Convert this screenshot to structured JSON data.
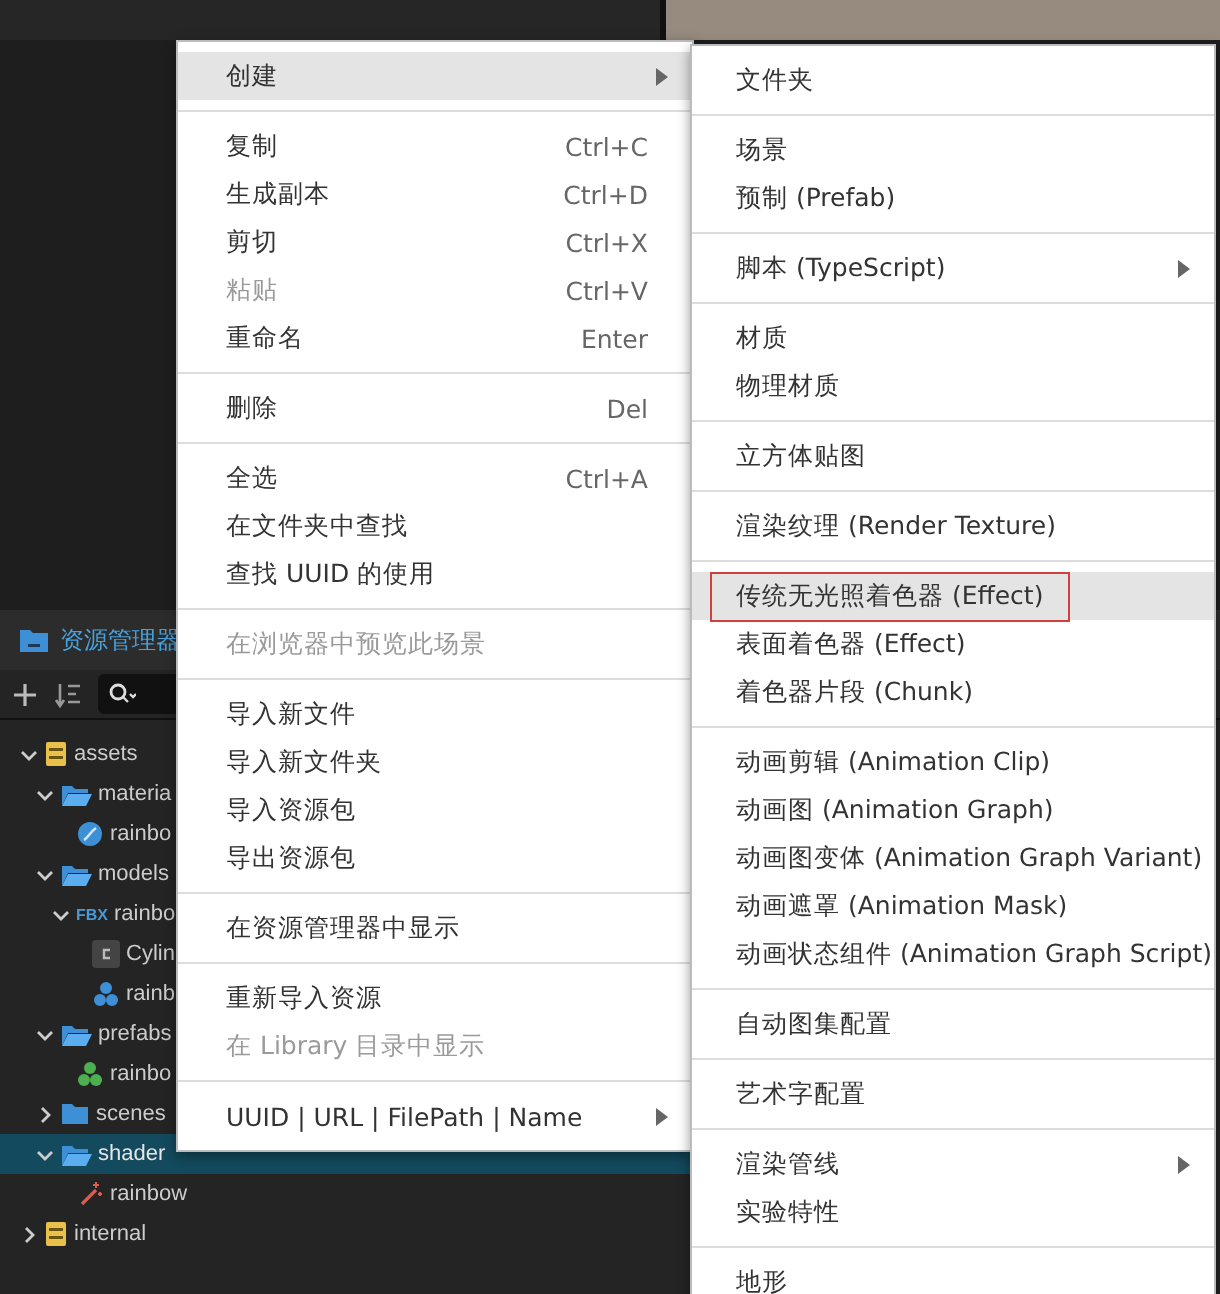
{
  "assets_panel": {
    "title": "资源管理器",
    "tree": [
      {
        "label": "assets",
        "kind": "database",
        "expanded": true,
        "selected": false,
        "children": [
          {
            "label": "materia",
            "kind": "folder",
            "expanded": true,
            "selected": false,
            "children": [
              {
                "label": "rainbo",
                "kind": "material",
                "selected": false
              }
            ]
          },
          {
            "label": "models",
            "kind": "folder",
            "expanded": true,
            "selected": false,
            "children": [
              {
                "label": "rainbo",
                "kind": "fbx",
                "tag": "FBX",
                "expanded": true,
                "selected": false,
                "children": [
                  {
                    "label": "Cylin",
                    "kind": "mesh",
                    "selected": false
                  },
                  {
                    "label": "rainb",
                    "kind": "prefab",
                    "color": "#3d8fd6",
                    "selected": false
                  }
                ]
              }
            ]
          },
          {
            "label": "prefabs",
            "kind": "folder",
            "expanded": true,
            "selected": false,
            "children": [
              {
                "label": "rainbo",
                "kind": "prefab",
                "color": "#4caf50",
                "selected": false
              }
            ]
          },
          {
            "label": "scenes",
            "kind": "folder",
            "expanded": false,
            "selected": false
          },
          {
            "label": "shader",
            "kind": "folder",
            "expanded": true,
            "selected": true,
            "children": [
              {
                "label": "rainbow",
                "kind": "shader",
                "selected": false
              }
            ]
          }
        ]
      },
      {
        "label": "internal",
        "kind": "database",
        "expanded": false,
        "selected": false
      }
    ]
  },
  "context_menu": {
    "groups": [
      [
        {
          "label": "创建",
          "submenu": true,
          "selected": true,
          "disabled": false
        }
      ],
      [
        {
          "label": "复制",
          "shortcut": "Ctrl+C",
          "selected": false,
          "disabled": false
        },
        {
          "label": "生成副本",
          "shortcut": "Ctrl+D",
          "selected": false,
          "disabled": false
        },
        {
          "label": "剪切",
          "shortcut": "Ctrl+X",
          "selected": false,
          "disabled": false
        },
        {
          "label": "粘贴",
          "shortcut": "Ctrl+V",
          "selected": false,
          "disabled": true
        },
        {
          "label": "重命名",
          "shortcut": "Enter",
          "selected": false,
          "disabled": false
        }
      ],
      [
        {
          "label": "删除",
          "shortcut": "Del",
          "selected": false,
          "disabled": false
        }
      ],
      [
        {
          "label": "全选",
          "shortcut": "Ctrl+A",
          "selected": false,
          "disabled": false
        },
        {
          "label": "在文件夹中查找",
          "selected": false,
          "disabled": false
        },
        {
          "label": "查找 UUID 的使用",
          "selected": false,
          "disabled": false
        }
      ],
      [
        {
          "label": "在浏览器中预览此场景",
          "selected": false,
          "disabled": true
        }
      ],
      [
        {
          "label": "导入新文件",
          "selected": false,
          "disabled": false
        },
        {
          "label": "导入新文件夹",
          "selected": false,
          "disabled": false
        },
        {
          "label": "导入资源包",
          "selected": false,
          "disabled": false
        },
        {
          "label": "导出资源包",
          "selected": false,
          "disabled": false
        }
      ],
      [
        {
          "label": "在资源管理器中显示",
          "selected": false,
          "disabled": false
        }
      ],
      [
        {
          "label": "重新导入资源",
          "selected": false,
          "disabled": false
        },
        {
          "label": "在 Library 目录中显示",
          "selected": false,
          "disabled": true
        }
      ],
      [
        {
          "label": "UUID | URL | FilePath | Name",
          "submenu": true,
          "selected": false,
          "disabled": false
        }
      ]
    ]
  },
  "create_submenu": {
    "groups": [
      [
        {
          "label": "文件夹",
          "selected": false,
          "disabled": false
        }
      ],
      [
        {
          "label": "场景",
          "selected": false,
          "disabled": false
        },
        {
          "label": "预制 (Prefab)",
          "selected": false,
          "disabled": false
        }
      ],
      [
        {
          "label": "脚本 (TypeScript)",
          "submenu": true,
          "selected": false,
          "disabled": false
        }
      ],
      [
        {
          "label": "材质",
          "selected": false,
          "disabled": false
        },
        {
          "label": "物理材质",
          "selected": false,
          "disabled": false
        }
      ],
      [
        {
          "label": "立方体贴图",
          "selected": false,
          "disabled": false
        }
      ],
      [
        {
          "label": "渲染纹理 (Render Texture)",
          "selected": false,
          "disabled": false
        }
      ],
      [
        {
          "label": "传统无光照着色器 (Effect)",
          "selected": true,
          "outlined": true,
          "disabled": false
        },
        {
          "label": "表面着色器 (Effect)",
          "selected": false,
          "disabled": false
        },
        {
          "label": "着色器片段 (Chunk)",
          "selected": false,
          "disabled": false
        }
      ],
      [
        {
          "label": "动画剪辑 (Animation Clip)",
          "selected": false,
          "disabled": false
        },
        {
          "label": "动画图 (Animation Graph)",
          "selected": false,
          "disabled": false
        },
        {
          "label": "动画图变体 (Animation Graph Variant)",
          "selected": false,
          "disabled": false
        },
        {
          "label": "动画遮罩 (Animation Mask)",
          "selected": false,
          "disabled": false
        },
        {
          "label": "动画状态组件 (Animation Graph Script)",
          "selected": false,
          "disabled": false
        }
      ],
      [
        {
          "label": "自动图集配置",
          "selected": false,
          "disabled": false
        }
      ],
      [
        {
          "label": "艺术字配置",
          "selected": false,
          "disabled": false
        }
      ],
      [
        {
          "label": "渲染管线",
          "submenu": true,
          "selected": false,
          "disabled": false
        },
        {
          "label": "实验特性",
          "selected": false,
          "disabled": false
        }
      ],
      [
        {
          "label": "地形",
          "selected": false,
          "disabled": false
        }
      ]
    ]
  }
}
